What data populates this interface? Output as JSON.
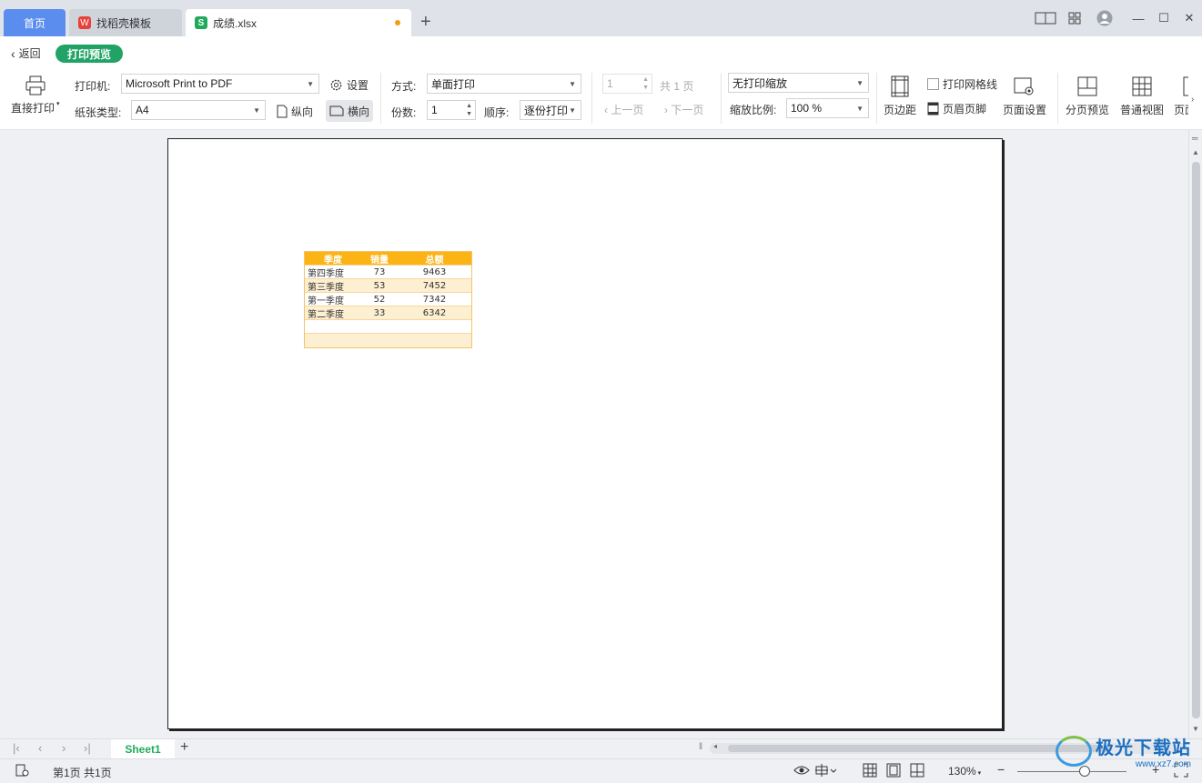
{
  "tabs": {
    "home": "首页",
    "template": "找稻壳模板",
    "template_icon": "W",
    "file": "成绩.xlsx",
    "file_icon": "S",
    "add": "+"
  },
  "window": {
    "minimize": "—",
    "maximize": "☐",
    "close": "✕"
  },
  "toolbar": {
    "back": "返回",
    "mode_badge": "打印预览",
    "direct_print": "直接打印",
    "printer_label": "打印机:",
    "printer_value": "Microsoft Print to PDF",
    "settings": "设置",
    "paper_label": "纸张类型:",
    "paper_value": "A4",
    "portrait": "纵向",
    "landscape": "横向",
    "method_label": "方式:",
    "method_value": "单面打印",
    "copies_label": "份数:",
    "copies_value": "1",
    "order_label": "顺序:",
    "order_value": "逐份打印",
    "page_input": "1",
    "page_total": "共 1 页",
    "prev_page": "上一页",
    "next_page": "下一页",
    "scale_value": "无打印缩放",
    "scale_ratio_label": "缩放比例:",
    "scale_ratio_value": "100 %",
    "margins": "页边距",
    "print_gridlines": "打印网格线",
    "header_footer": "页眉页脚",
    "page_setup": "页面设置",
    "page_break_preview": "分页预览",
    "normal_view": "普通视图",
    "page_layout": "页面"
  },
  "sheet_table": {
    "headers": [
      "季度",
      "销量",
      "总额"
    ],
    "rows": [
      [
        "第四季度",
        "73",
        "9463"
      ],
      [
        "第三季度",
        "53",
        "7452"
      ],
      [
        "第一季度",
        "52",
        "7342"
      ],
      [
        "第二季度",
        "33",
        "6342"
      ]
    ],
    "header_color": "#fbb316",
    "band_color": "#fdefd2"
  },
  "sheet_tabs": {
    "active": "Sheet1",
    "add": "+"
  },
  "status": {
    "page_info": "第1页 共1页",
    "zoom": "130%",
    "zoom_out": "−",
    "zoom_in": "+"
  },
  "watermark": {
    "title": "极光下载站",
    "url": "www.xz7.com"
  }
}
